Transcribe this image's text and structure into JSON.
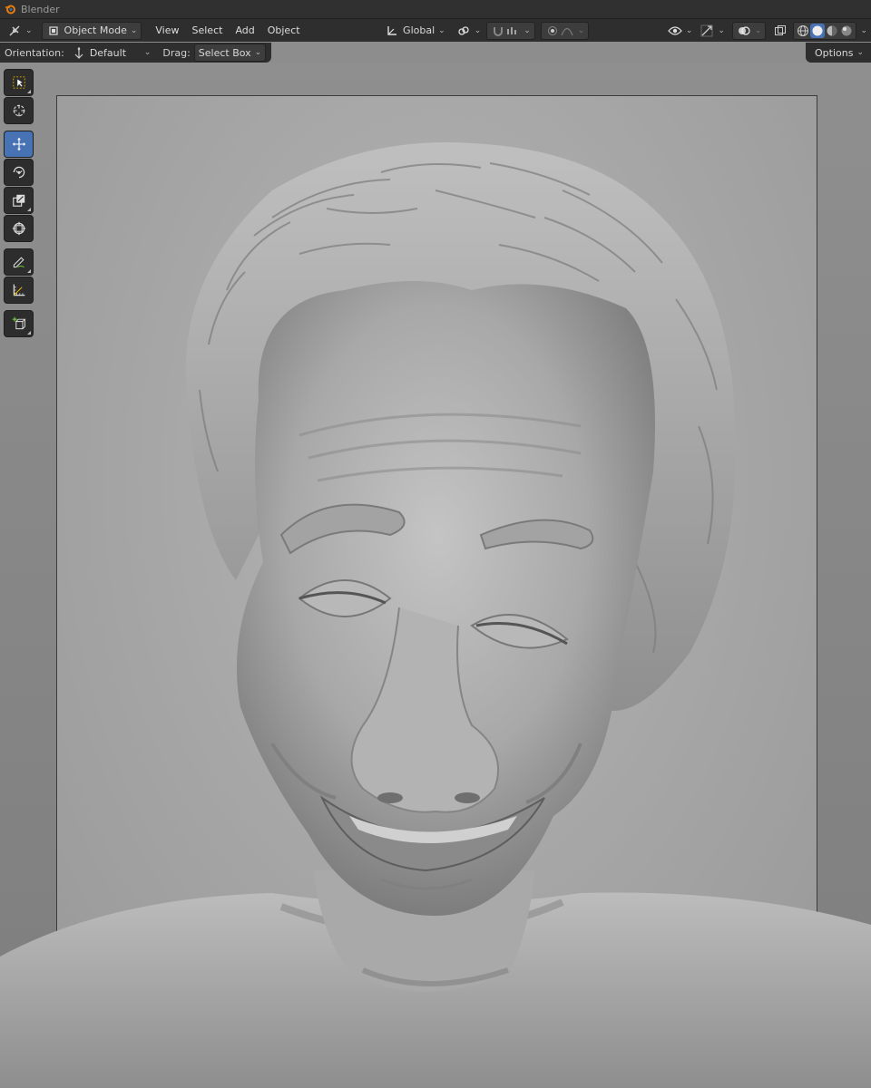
{
  "window": {
    "title": "Blender"
  },
  "header": {
    "mode": "Object Mode",
    "menus": [
      "View",
      "Select",
      "Add",
      "Object"
    ],
    "transform_orientation": "Global"
  },
  "tool_settings": {
    "orientation_label": "Orientation:",
    "orientation_value": "Default",
    "drag_label": "Drag:",
    "drag_value": "Select Box",
    "options_label": "Options"
  },
  "colors": {
    "active_tool": "#4772b3",
    "header_bg": "#2e2e2e",
    "accent_orange": "#e87d0d"
  }
}
